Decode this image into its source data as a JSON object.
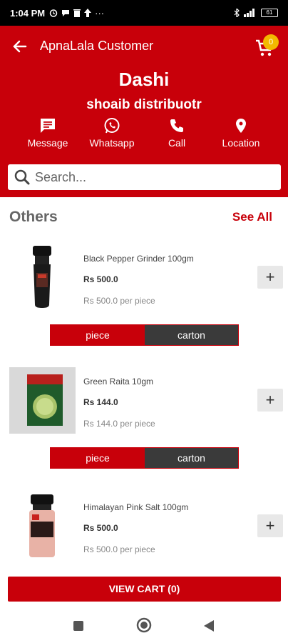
{
  "status_bar": {
    "time": "1:04 PM",
    "battery": "61"
  },
  "header": {
    "app_title": "ApnaLala Customer",
    "cart_count": "0",
    "shop_name": "Dashi",
    "distributor": "shoaib distribuotr",
    "actions": [
      {
        "label": "Message",
        "icon": "message-icon"
      },
      {
        "label": "Whatsapp",
        "icon": "whatsapp-icon"
      },
      {
        "label": "Call",
        "icon": "phone-icon"
      },
      {
        "label": "Location",
        "icon": "location-pin-icon"
      }
    ]
  },
  "search": {
    "placeholder": "Search..."
  },
  "section": {
    "title": "Others",
    "see_all": "See All"
  },
  "products": [
    {
      "name": "Black Pepper Grinder 100gm",
      "price": "Rs 500.0",
      "per_piece": "Rs 500.0 per piece",
      "unit_on": "piece",
      "unit_off": "carton"
    },
    {
      "name": "Green Raita 10gm",
      "price": "Rs 144.0",
      "per_piece": "Rs 144.0 per piece",
      "unit_on": "piece",
      "unit_off": "carton"
    },
    {
      "name": "Himalayan Pink Salt 100gm",
      "price": "Rs 500.0",
      "per_piece": "Rs 500.0 per piece"
    }
  ],
  "view_cart": "VIEW CART (0)",
  "colors": {
    "primary": "#c8000a",
    "toggle_off": "#3a3a3a",
    "badge": "#f3b800"
  }
}
